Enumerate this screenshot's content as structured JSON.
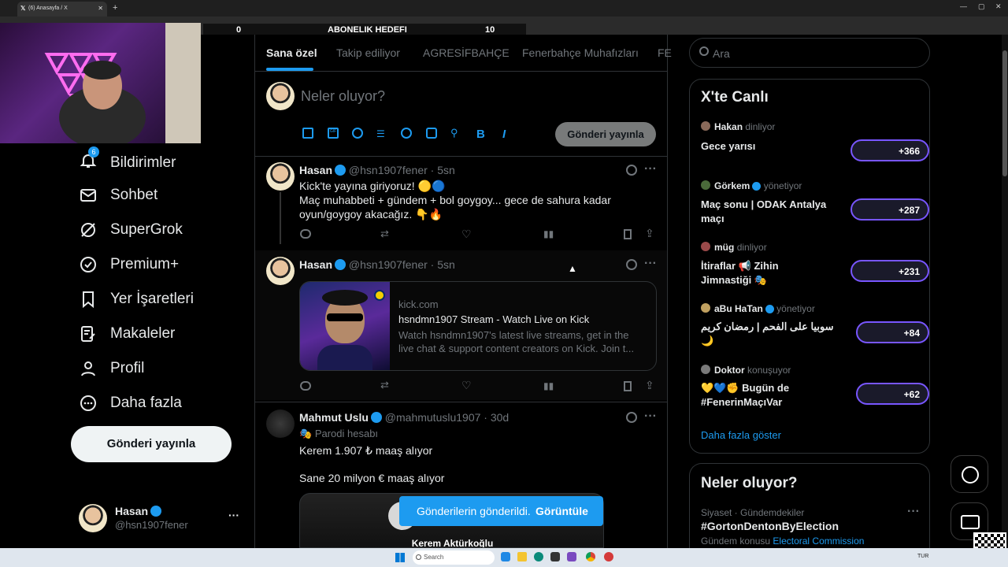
{
  "browser": {
    "tab_title": "(6) Anasayfa / X"
  },
  "stream_overlay": {
    "left_value": "0",
    "title": "ABONELIK HEDEFI",
    "right_value": "10"
  },
  "sidebar": {
    "notifications_badge": "6",
    "items": [
      {
        "label": "Bildirimler",
        "icon": "bell-icon"
      },
      {
        "label": "Sohbet",
        "icon": "mail-icon"
      },
      {
        "label": "SuperGrok",
        "icon": "grok-icon"
      },
      {
        "label": "Premium+",
        "icon": "verified-icon"
      },
      {
        "label": "Yer İşaretleri",
        "icon": "bookmark-icon"
      },
      {
        "label": "Makaleler",
        "icon": "article-icon"
      },
      {
        "label": "Profil",
        "icon": "person-icon"
      },
      {
        "label": "Daha fazla",
        "icon": "more-circle-icon"
      }
    ],
    "post_button": "Gönderi yayınla",
    "account": {
      "name": "Hasan",
      "handle": "@hsn1907fener",
      "more": "···"
    }
  },
  "feed": {
    "tabs": [
      "Sana özel",
      "Takip ediliyor",
      "AGRESİFBAHÇE",
      "Fenerbahçe Muhafızları",
      "FE"
    ],
    "compose": {
      "placeholder": "Neler oluyor?",
      "post_button": "Gönderi yayınla"
    },
    "tweets": [
      {
        "name": "Hasan",
        "handle": "@hsn1907fener · 5sn",
        "lines": [
          "Kick'te yayına giriyoruz! 🟡🔵",
          "Maç muhabbeti + gündem + bol goygoy... gece de sahura kadar",
          "oyun/goygoy akacağız. 👇🔥"
        ]
      },
      {
        "name": "Hasan",
        "handle": "@hsn1907fener · 5sn",
        "card": {
          "domain": "kick.com",
          "title": "hsndmn1907 Stream - Watch Live on Kick",
          "desc1": "Watch hsndmn1907's latest live streams, get in the",
          "desc2": "live chat & support content creators on Kick. Join t..."
        }
      },
      {
        "name": "Mahmut Uslu",
        "handle": "@mahmutuslu1907 · 30d",
        "parody": "Parodi hesabı",
        "line1": "Kerem 1.907 ₺ maaş alıyor",
        "line2": "Sane 20 milyon € maaş alıyor",
        "media_caption": "Kerem Aktürkoğlu"
      }
    ],
    "toast": {
      "text": "Gönderilerin gönderildi.",
      "action": "Görüntüle"
    }
  },
  "right": {
    "search_placeholder": "Ara",
    "live": {
      "title": "X'te Canlı",
      "items": [
        {
          "host": "Hakan",
          "role": "dinliyor",
          "title1": "Gece yarısı",
          "title2": "",
          "count": "+366"
        },
        {
          "host": "Görkem",
          "role": "yönetiyor",
          "title1": "Maç sonu | ODAK Antalya",
          "title2": "maçı",
          "count": "+287"
        },
        {
          "host": "müg",
          "role": "dinliyor",
          "title1": "İtiraflar 📢 Zihin",
          "title2": "Jimnastiği 🎭",
          "count": "+231"
        },
        {
          "host": "aBu HaTan",
          "role": "yönetiyor",
          "title1": "سوبيا على الفحم | رمضان كريم",
          "title2": "🌙",
          "count": "+84"
        },
        {
          "host": "Doktor",
          "role": "konuşuyor",
          "title1": "💛💙✊ Bugün de",
          "title2": "#FenerinMaçıVar",
          "count": "+62"
        }
      ],
      "show_more": "Daha fazla göster"
    },
    "trends": {
      "title": "Neler oluyor?",
      "meta": "Siyaset · Gündemdekiler",
      "topic": "#GortonDentonByElection",
      "sub_label": "Gündem konusu",
      "sub_link": "Electoral Commission"
    }
  },
  "taskbar": {
    "search": "Search",
    "lang": "TUR"
  },
  "colors": {
    "accent": "#1d9bf0",
    "live_ring": "#7856ff",
    "bg": "#000000"
  }
}
